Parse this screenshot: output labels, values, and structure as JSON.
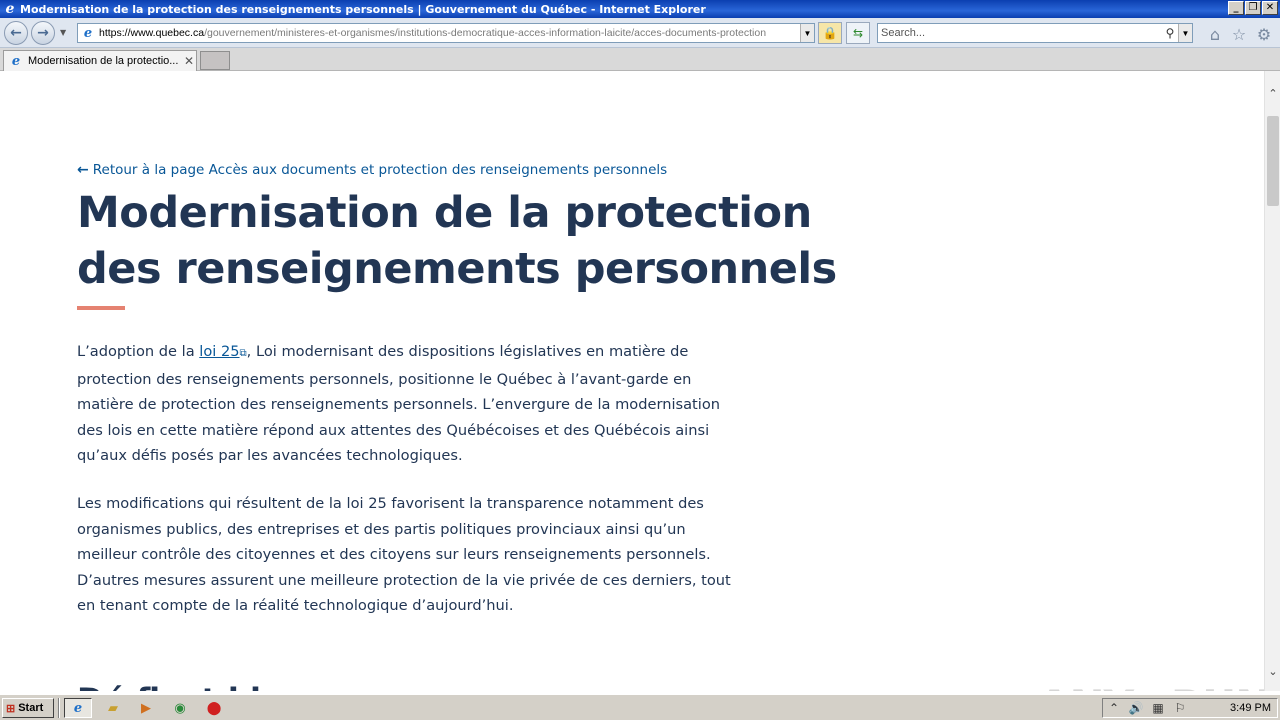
{
  "window": {
    "title": "Modernisation de la protection des renseignements personnels | Gouvernement du Québec - Internet Explorer",
    "minimize_glyph": "_",
    "restore_glyph": "❐",
    "close_glyph": "✕"
  },
  "address_bar": {
    "url_scheme_host": "https://www.quebec.ca",
    "url_path": "/gouvernement/ministeres-et-organismes/institutions-democratique-acces-information-laicite/acces-documents-protection",
    "search_placeholder": "Search..."
  },
  "tabs": [
    {
      "label": "Modernisation de la protectio...",
      "close_glyph": "✕"
    }
  ],
  "page": {
    "back_link": "Retour à la page Accès aux documents et protection des renseignements personnels",
    "title": "Modernisation de la protection des renseignements personnels",
    "para1_before": "L’adoption de la ",
    "para1_link": "loi 25",
    "para1_after": ", Loi modernisant des dispositions législatives en matière de protection des renseignements personnels, positionne le Québec à l’avant-garde en matière de protection des renseignements personnels. L’envergure de la modernisation des lois en cette matière répond aux attentes des Québécoises et des Québécois ainsi qu’aux défis posés par les avancées technologiques.",
    "para2": "Les modifications qui résultent de la loi 25 favorisent la transparence notamment des organismes publics, des entreprises et des partis politiques provinciaux ainsi qu’un meilleur contrôle des citoyennes et des citoyens sur leurs renseignements personnels. D’autres mesures assurent une meilleure protection de la vie privée de ces derniers, tout en tenant compte de la réalité technologique d’aujourd’hui.",
    "next_heading_partial": "Dé  fi  s    t      l     i"
  },
  "watermark": {
    "text": "ANY",
    "text2": "RUN"
  },
  "taskbar": {
    "start_label": "Start",
    "clock": "3:49 PM"
  },
  "colors": {
    "heading": "#223654",
    "link": "#095797",
    "accent_bar": "#e58271",
    "titlebar": "#0b3fb0"
  },
  "icons": {
    "back": "arrow-left-icon",
    "external": "external-link-icon",
    "home": "home-icon",
    "favorites": "star-icon",
    "tools": "gear-icon"
  }
}
